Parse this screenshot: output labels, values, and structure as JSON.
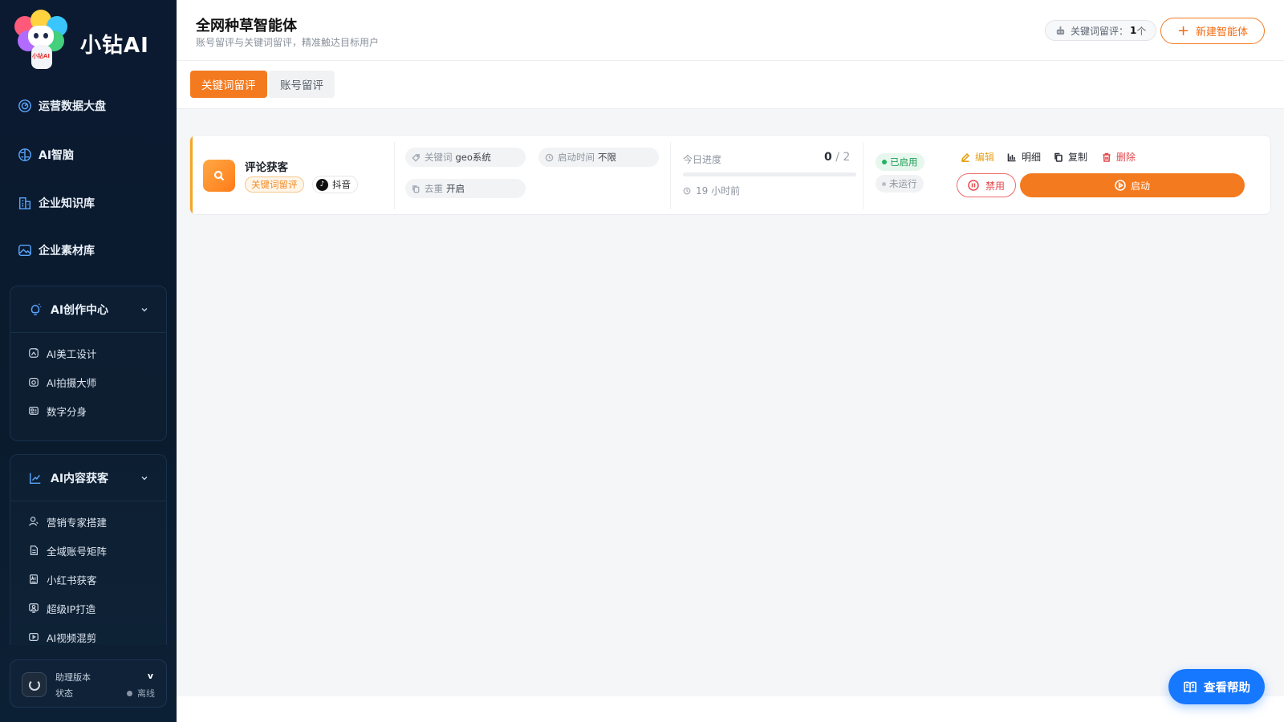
{
  "brand": {
    "name": "小钻AI",
    "logo_badge": "小钻AI"
  },
  "sidebar": {
    "items": [
      {
        "label": "运营数据大盘",
        "icon": "gauge-icon"
      },
      {
        "label": "AI智脑",
        "icon": "brain-icon"
      },
      {
        "label": "企业知识库",
        "icon": "building-icon"
      },
      {
        "label": "企业素材库",
        "icon": "image-icon"
      }
    ],
    "groups": [
      {
        "label": "AI创作中心",
        "icon": "bulb-icon",
        "items": [
          {
            "label": "AI美工设计",
            "icon": "palette-icon"
          },
          {
            "label": "AI拍摄大师",
            "icon": "camera-icon"
          },
          {
            "label": "数字分身",
            "icon": "id-card-icon"
          }
        ]
      },
      {
        "label": "AI内容获客",
        "icon": "trend-icon",
        "items": [
          {
            "label": "营销专家搭建",
            "icon": "user-icon"
          },
          {
            "label": "全域账号矩阵",
            "icon": "doc-icon"
          },
          {
            "label": "小红书获客",
            "icon": "ai-doc-icon"
          },
          {
            "label": "超级IP打造",
            "icon": "ip-icon"
          },
          {
            "label": "AI视频混剪",
            "icon": "video-icon"
          }
        ]
      }
    ],
    "helper": {
      "title": "助理版本",
      "version": "v",
      "status_label": "状态",
      "status_value": "离线"
    }
  },
  "header": {
    "title": "全网种草智能体",
    "subtitle": "账号留评与关键词留评，精准触达目标用户",
    "kw_stat_label": "关键词留评：",
    "kw_stat_value": "1",
    "kw_stat_unit": " 个",
    "new_button": "新建智能体"
  },
  "tabs": [
    {
      "label": "关键词留评",
      "active": true
    },
    {
      "label": "账号留评",
      "active": false
    }
  ],
  "agents": [
    {
      "name": "评论获客",
      "type_tag": "关键词留评",
      "platform": "抖音",
      "keyword_label": "关键词",
      "keyword_value": "geo系统",
      "start_time_label": "启动时间",
      "start_time_value": "不限",
      "dedup_label": "去重",
      "dedup_value": "开启",
      "progress_label": "今日进度",
      "progress_done": "0",
      "progress_total": "/ 2",
      "progress_ratio": 0,
      "last_run": "19 小时前",
      "status_enabled": "已启用",
      "status_run": "未运行",
      "actions": {
        "edit": "编辑",
        "detail": "明细",
        "copy": "复制",
        "delete": "删除"
      },
      "disable_button": "禁用",
      "start_button": "启动"
    }
  ],
  "help_button": "查看帮助",
  "colors": {
    "accent": "#f47a1f",
    "sidebar_bg": "#0b1a30",
    "help_blue": "#1677ff",
    "success": "#22b463",
    "danger": "#e5484d"
  }
}
